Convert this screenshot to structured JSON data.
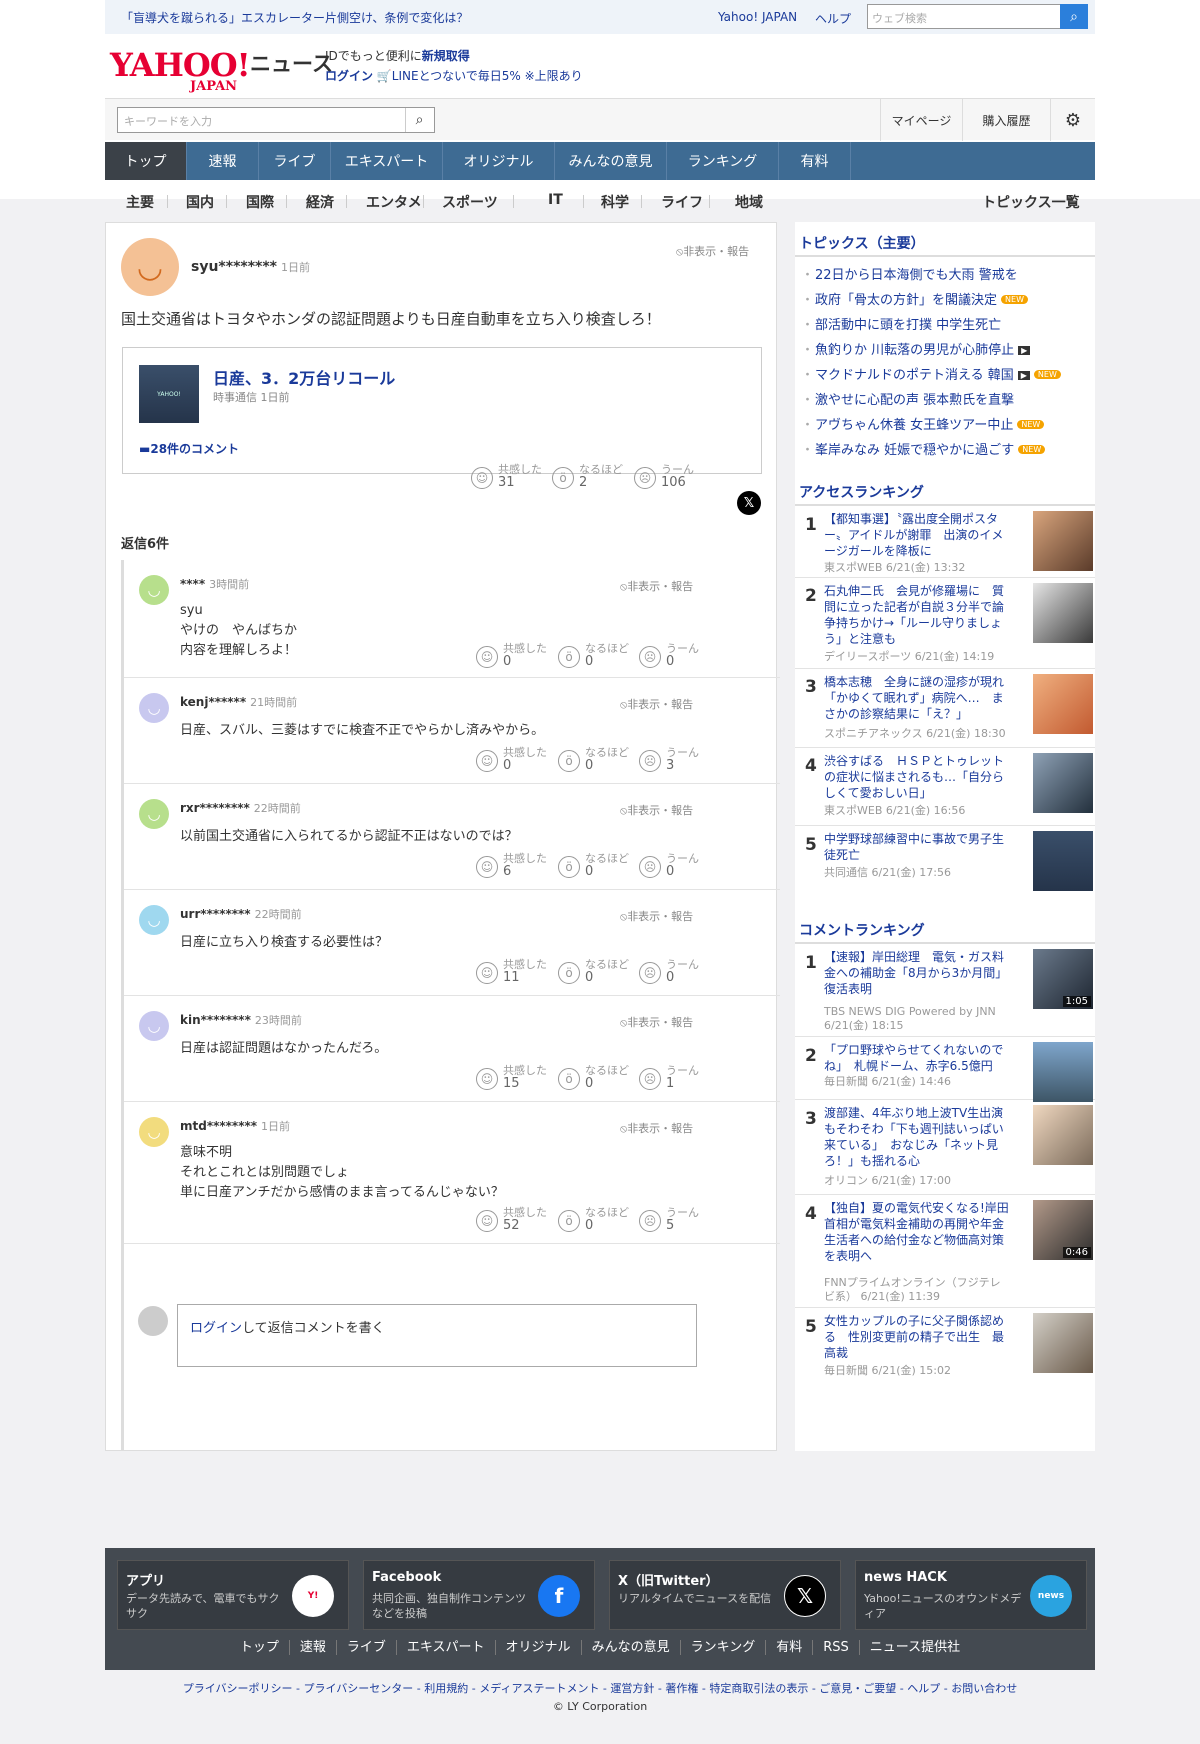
{
  "topbar": {
    "headline": "「盲導犬を蹴られる」エスカレーター片側空け、条例で変化は？",
    "yahoo_japan": "Yahoo! JAPAN",
    "help": "ヘルプ",
    "web_search_placeholder": "ウェブ検索"
  },
  "header": {
    "logo": "YAHOO!",
    "logo_sub": "JAPAN",
    "logo_news": "ニュース",
    "promo_line1": "IDでもっと便利に",
    "promo_new": "新規取得",
    "promo_login": "ログイン",
    "promo_line2": "LINEとつないで毎日5% ※上限あり",
    "keyword_placeholder": "キーワードを入力",
    "mypage": "マイページ",
    "history": "購入履歴"
  },
  "nav": {
    "tabs": [
      "トップ",
      "速報",
      "ライブ",
      "エキスパート",
      "オリジナル",
      "みんなの意見",
      "ランキング",
      "有料"
    ],
    "sub": [
      "主要",
      "国内",
      "国際",
      "経済",
      "エンタメ",
      "スポーツ",
      "IT",
      "科学",
      "ライフ",
      "地域"
    ],
    "topics_all": "トピックス一覧"
  },
  "comment": {
    "user": "syu********",
    "time": "1日前",
    "hide": "非表示・報告",
    "text": "国土交通省はトヨタやホンダの認証問題よりも日産自動車を立ち入り検査しろ！",
    "article_title": "日産、3．2万台リコール",
    "article_source": "時事通信 1日前",
    "comment_count": "28件のコメント",
    "reactions": {
      "agree_label": "共感した",
      "agree": "31",
      "wow_label": "なるほど",
      "wow": "2",
      "hmm_label": "うーん",
      "hmm": "106"
    }
  },
  "replies_header": "返信6件",
  "replies": [
    {
      "user": "****",
      "time": "3時間前",
      "text": "syu\nやけの　やんばちか\n内容を理解しろよ！",
      "agree": "0",
      "wow": "0",
      "hmm": "0",
      "color": "#b7df8c"
    },
    {
      "user": "kenj******",
      "time": "21時間前",
      "text": "日産、スバル、三菱はすでに検査不正でやらかし済みやから。",
      "agree": "0",
      "wow": "0",
      "hmm": "3",
      "color": "#c8c8ef"
    },
    {
      "user": "rxr********",
      "time": "22時間前",
      "text": "以前国土交通省に入られてるから認証不正はないのでは？",
      "agree": "6",
      "wow": "0",
      "hmm": "0",
      "color": "#b7df8c"
    },
    {
      "user": "urr********",
      "time": "22時間前",
      "text": "日産に立ち入り検査する必要性は？",
      "agree": "11",
      "wow": "0",
      "hmm": "0",
      "color": "#9fd8ef"
    },
    {
      "user": "kin********",
      "time": "23時間前",
      "text": "日産は認証問題はなかったんだろ。",
      "agree": "15",
      "wow": "0",
      "hmm": "1",
      "color": "#c8c8ef"
    },
    {
      "user": "mtd********",
      "time": "1日前",
      "text": "意味不明\nそれとこれとは別問題でしょ\n単に日産アンチだから感情のまま言ってるんじゃない？",
      "agree": "52",
      "wow": "0",
      "hmm": "5",
      "color": "#f2dc7e"
    }
  ],
  "login_prompt": {
    "link": "ログイン",
    "rest": "して返信コメントを書く"
  },
  "topics": {
    "title": "トピックス（主要）",
    "items": [
      {
        "text": "22日から日本海側でも大雨 警戒を",
        "badge": ""
      },
      {
        "text": "政府「骨太の方針」を閣議決定",
        "badge": "NEW"
      },
      {
        "text": "部活動中に頭を打撲 中学生死亡",
        "badge": ""
      },
      {
        "text": "魚釣りか 川転落の男児が心肺停止",
        "badge": "video"
      },
      {
        "text": "マクドナルドのポテト消える 韓国",
        "badge": "video+new"
      },
      {
        "text": "激やせに心配の声 張本勲氏を直撃",
        "badge": ""
      },
      {
        "text": "アヴちゃん休養 女王蜂ツアー中止",
        "badge": "NEW"
      },
      {
        "text": "峯岸みなみ 妊娠で穏やかに過ごす",
        "badge": "NEW"
      }
    ]
  },
  "access_ranking": {
    "title": "アクセスランキング",
    "items": [
      {
        "rank": "1",
        "title": "【都知事選】〝露出度全開ポスター〟アイドルが謝罪　出演のイメージガールを降板に",
        "source": "東スポWEB 6/21(金) 13:32"
      },
      {
        "rank": "2",
        "title": "石丸伸二氏　会見が修羅場に　質問に立った記者が自説３分半で論争持ちかけ→「ルール守りましょう」と注意も",
        "source": "デイリースポーツ 6/21(金) 14:19"
      },
      {
        "rank": "3",
        "title": "橋本志穂　全身に謎の湿疹が現れ「かゆくて眠れず」病院へ…　まさかの診察結果に「え？」",
        "source": "スポニチアネックス 6/21(金) 18:30"
      },
      {
        "rank": "4",
        "title": "渋谷すばる　ＨＳＰとトゥレットの症状に悩まされるも…「自分らしくて愛おしい日」",
        "source": "東スポWEB 6/21(金) 16:56"
      },
      {
        "rank": "5",
        "title": "中学野球部練習中に事故で男子生徒死亡",
        "source": "共同通信 6/21(金) 17:56"
      }
    ]
  },
  "comment_ranking": {
    "title": "コメントランキング",
    "items": [
      {
        "rank": "1",
        "title": "【速報】岸田総理　電気・ガス料金への補助金「8月から3か月間」復活表明",
        "source": "TBS NEWS DIG Powered by JNN 6/21(金) 18:15",
        "duration": "1:05"
      },
      {
        "rank": "2",
        "title": "「プロ野球やらせてくれないのでね」　札幌ドーム、赤字6.5億円",
        "source": "毎日新聞 6/21(金) 14:46",
        "duration": ""
      },
      {
        "rank": "3",
        "title": "渡部建、4年ぶり地上波TV生出演もそわそわ「下も週刊誌いっぱい来ている」　おなじみ「ネット見ろ！」も揺れる心",
        "source": "オリコン 6/21(金) 17:00",
        "duration": ""
      },
      {
        "rank": "4",
        "title": "【独自】夏の電気代安くなる!岸田首相が電気料金補助の再開や年金生活者への給付金など物価高対策を表明へ",
        "source": "FNNプライムオンライン（フジテレビ系） 6/21(金) 11:39",
        "duration": "0:46"
      },
      {
        "rank": "5",
        "title": "女性カップルの子に父子関係認める　性別変更前の精子で出生　最高裁",
        "source": "毎日新聞 6/21(金) 15:02",
        "duration": ""
      }
    ]
  },
  "footer": {
    "cards": [
      {
        "title": "アプリ",
        "desc": "データ先読みで、電車でもサクサク",
        "icon": "yahoo-app-icon"
      },
      {
        "title": "Facebook",
        "desc": "共同企画、独自制作コンテンツなどを投稿",
        "icon": "facebook-icon"
      },
      {
        "title": "X（旧Twitter）",
        "desc": "リアルタイムでニュースを配信",
        "icon": "x-icon"
      },
      {
        "title": "news HACK",
        "desc": "Yahoo!ニュースのオウンドメディア",
        "icon": "news-hack-icon"
      }
    ],
    "nav": [
      "トップ",
      "速報",
      "ライブ",
      "エキスパート",
      "オリジナル",
      "みんなの意見",
      "ランキング",
      "有料",
      "RSS",
      "ニュース提供社"
    ],
    "legal": "プライバシーポリシー - プライバシーセンター - 利用規約 - メディアステートメント - 運営方針 - 著作権 - 特定商取引法の表示 - ご意見・ご要望 - ヘルプ - お問い合わせ",
    "copyright": "© LY Corporation"
  },
  "colors": {
    "accent": "#3e6b93",
    "link": "#1a3a9a",
    "brand": "#e60033"
  }
}
